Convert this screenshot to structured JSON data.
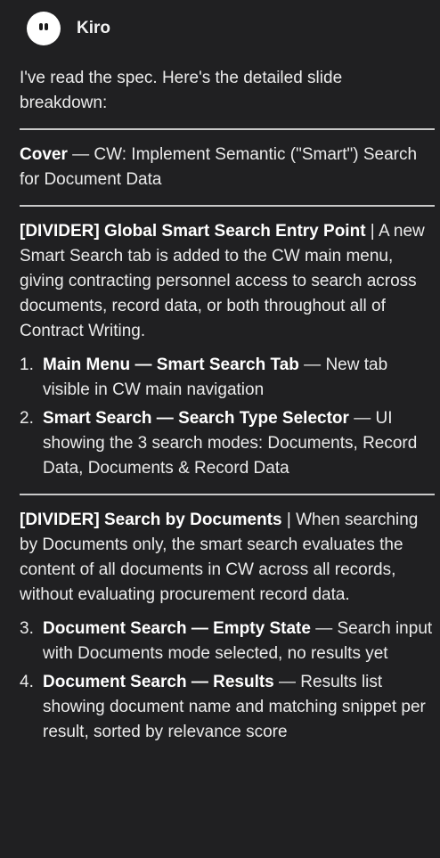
{
  "header": {
    "name": "Kiro"
  },
  "intro": "I've read the spec. Here's the detailed slide breakdown:",
  "cover": {
    "label": "Cover",
    "text": " — CW: Implement Semantic (\"Smart\") Search for Document Data"
  },
  "sections": [
    {
      "title": "[DIVIDER] Global Smart Search Entry Point",
      "text": " | A new Smart Search tab is added to the CW main menu, giving contracting personnel access to search across documents, record data, or both throughout all of Contract Writing.",
      "items": [
        {
          "num": "1.",
          "title": "Main Menu — Smart Search Tab",
          "text": " — New tab visible in CW main navigation"
        },
        {
          "num": "2.",
          "title": "Smart Search — Search Type Selector",
          "text": " — UI showing the 3 search modes: Documents, Record Data, Documents & Record Data"
        }
      ]
    },
    {
      "title": "[DIVIDER] Search by Documents",
      "text": " | When searching by Documents only, the smart search evaluates the content of all documents in CW across all records, without evaluating procurement record data.",
      "items": [
        {
          "num": "3.",
          "title": "Document Search — Empty State",
          "text": " — Search input with Documents mode selected, no results yet"
        },
        {
          "num": "4.",
          "title": "Document Search — Results",
          "text": " — Results list showing document name and matching snippet per result, sorted by relevance score"
        }
      ]
    }
  ]
}
